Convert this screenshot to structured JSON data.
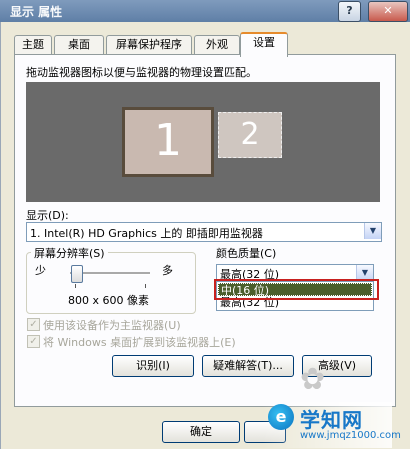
{
  "window": {
    "title": "显示 属性",
    "help_glyph": "?",
    "close_glyph": "✕"
  },
  "tabs": [
    {
      "label": "主题"
    },
    {
      "label": "桌面"
    },
    {
      "label": "屏幕保护程序"
    },
    {
      "label": "外观"
    },
    {
      "label": "设置"
    }
  ],
  "active_tab": "设置",
  "instruction": "拖动监视器图标以便与监视器的物理设置匹配。",
  "monitors": [
    {
      "number": "1"
    },
    {
      "number": "2"
    }
  ],
  "display": {
    "label": "显示(D):",
    "value": "1. Intel(R) HD Graphics 上的 即插即用监视器"
  },
  "resolution": {
    "title": "屏幕分辨率(S)",
    "low": "少",
    "high": "多",
    "value_text": "800 x 600 像素",
    "slider_fraction": 0.0
  },
  "color_quality": {
    "title": "颜色质量(C)",
    "selected": "最高(32 位)",
    "options": [
      "中(16 位)",
      "最高(32 位)"
    ],
    "highlighted": "中(16 位)"
  },
  "checkboxes": [
    {
      "label": "使用该设备作为主监视器(U)",
      "checked": true,
      "enabled": false
    },
    {
      "label": "将 Windows 桌面扩展到该监视器上(E)",
      "checked": true,
      "enabled": false
    }
  ],
  "buttons": {
    "identify": "识别(I)",
    "troubleshoot": "疑难解答(T)...",
    "advanced": "高级(V)",
    "ok": "确定"
  },
  "watermark": {
    "logo_char": "e",
    "title": "学知网",
    "url": "www.jmqz1000.com"
  },
  "colors": {
    "highlight": "#4b5e2c",
    "annotation_box": "#c8211f",
    "preview_bg": "#6a6a6a"
  }
}
